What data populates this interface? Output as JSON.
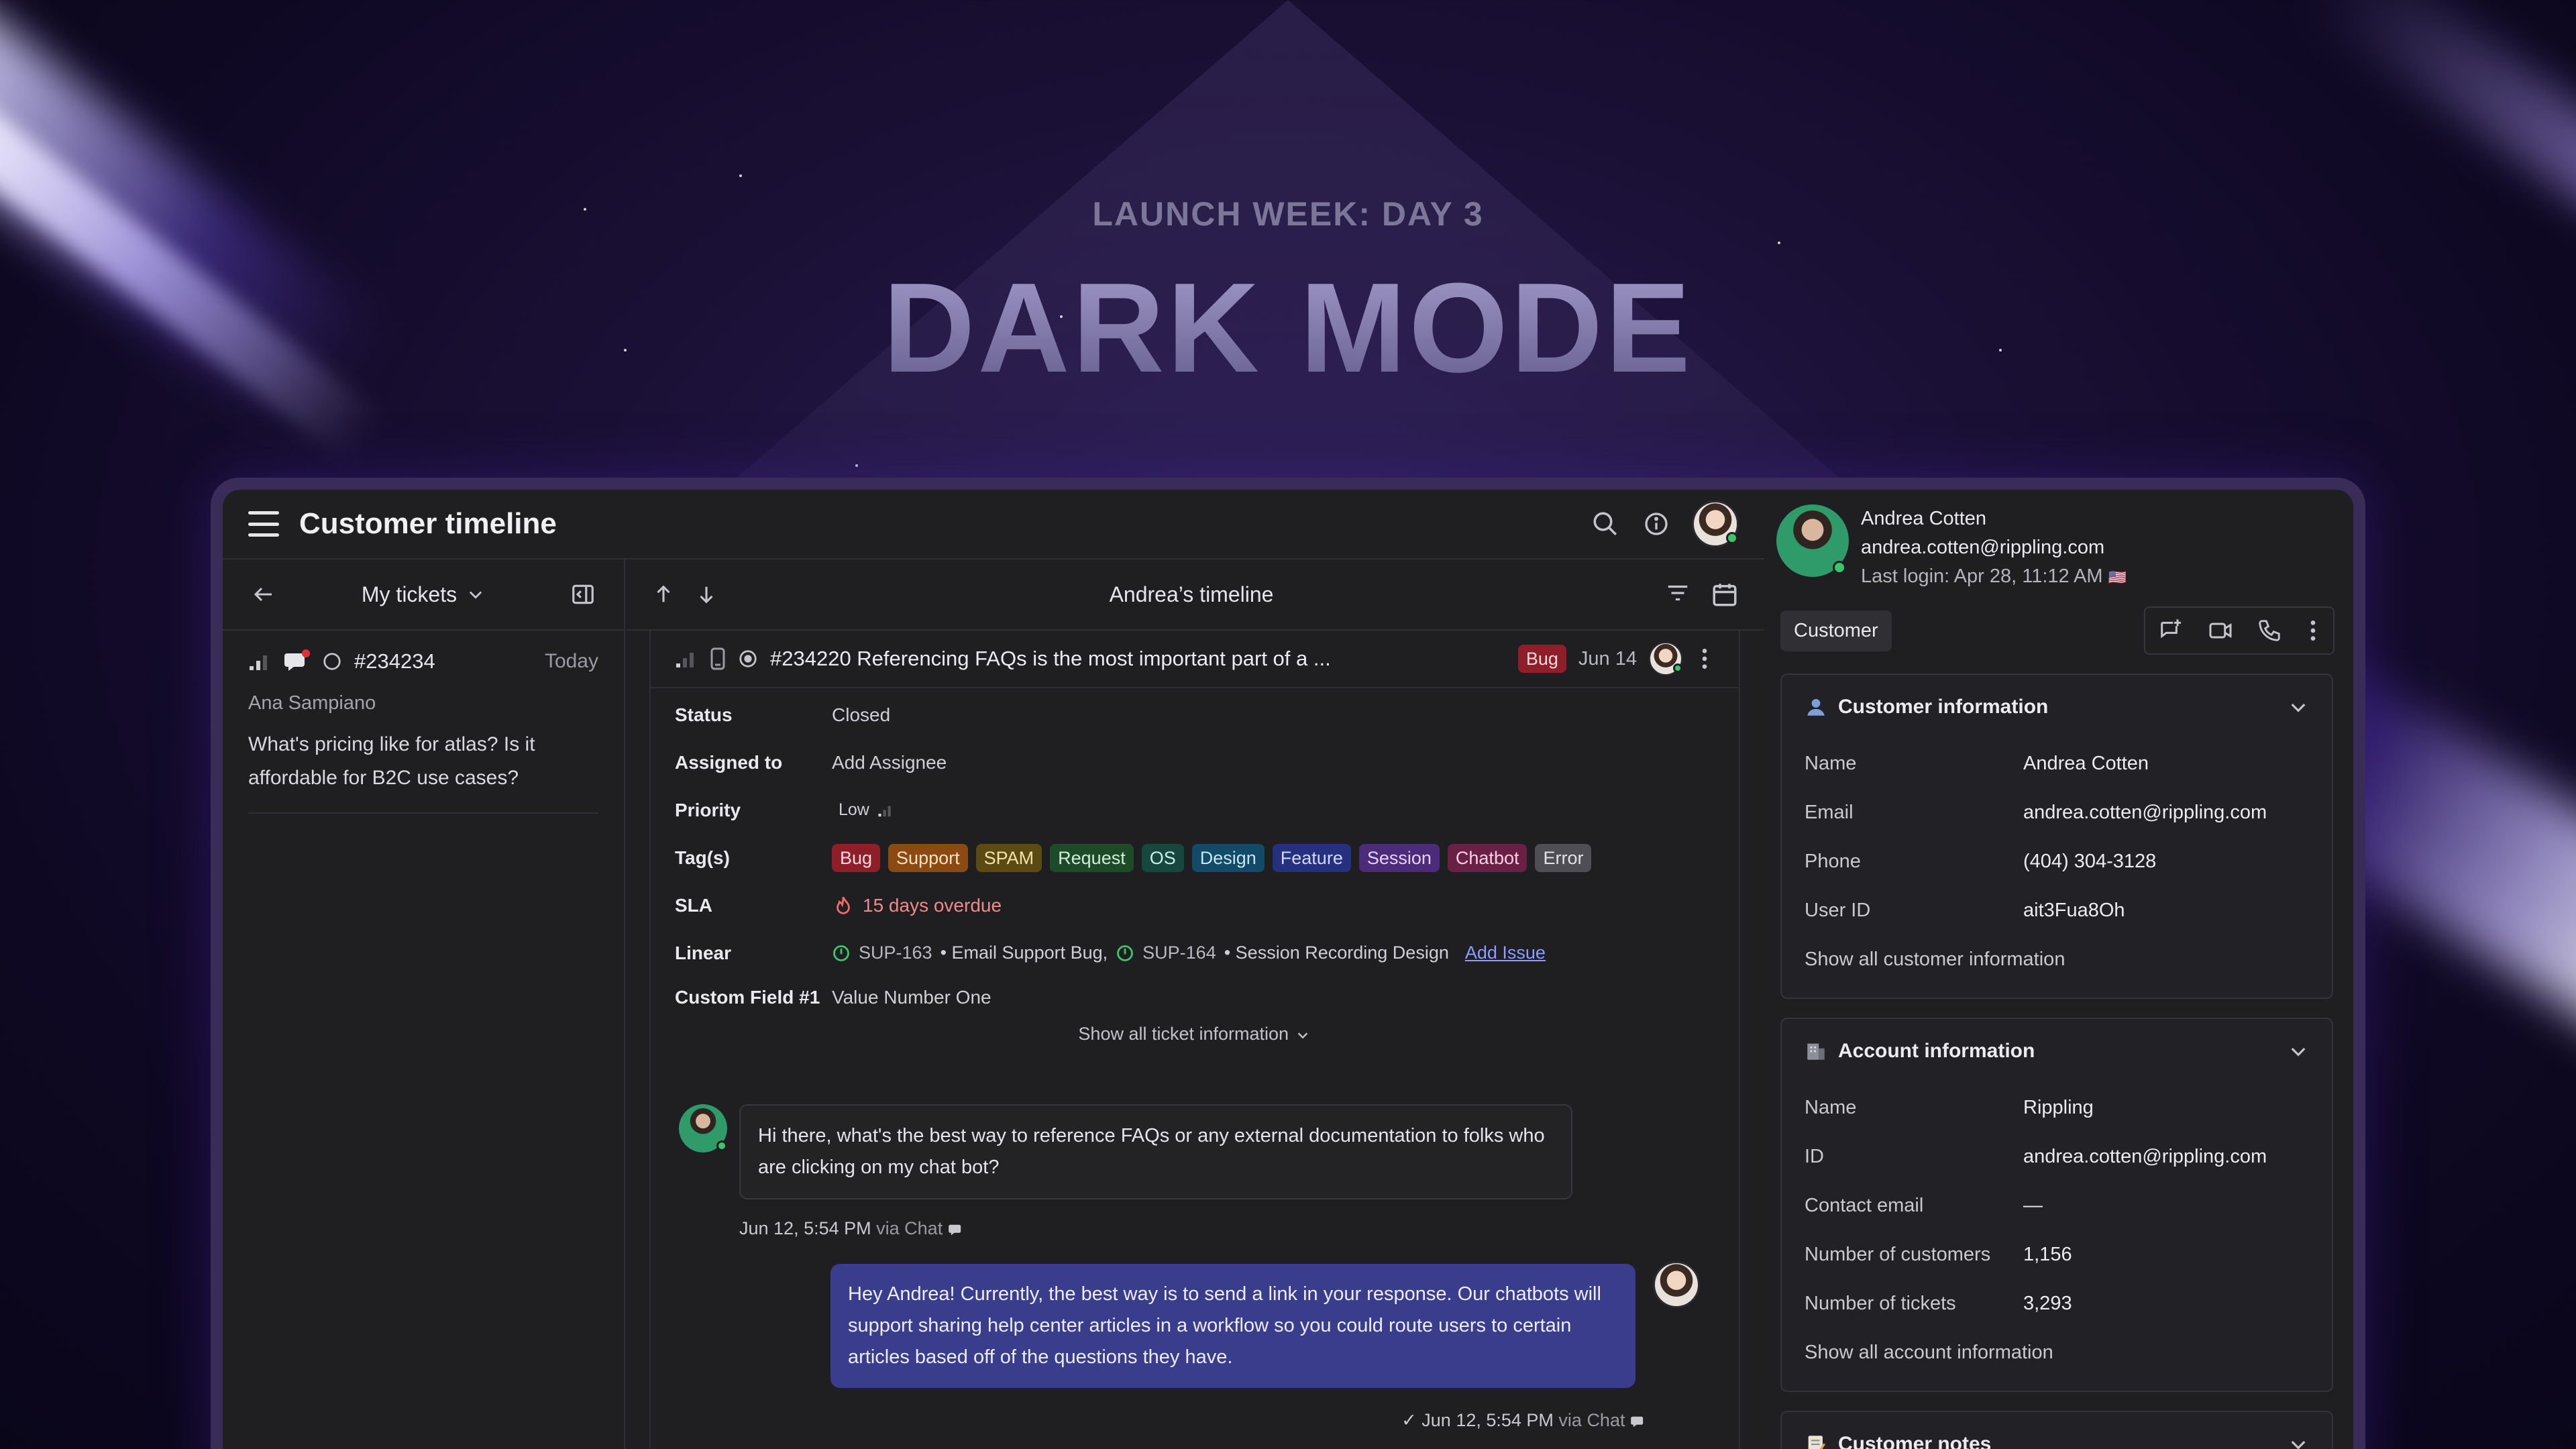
{
  "banner": {
    "eyebrow": "LAUNCH WEEK: DAY 3",
    "headline": "DARK MODE"
  },
  "app": {
    "title": "Customer timeline",
    "left": {
      "filter_label": "My tickets",
      "ticket": {
        "number": "#234234",
        "when": "Today",
        "customer": "Ana Sampiano",
        "message": "What's pricing like for atlas? Is it affordable for B2C use cases?"
      }
    },
    "timeline": {
      "title": "Andrea’s timeline",
      "ticket": {
        "title": "#234220 Referencing FAQs is the most important part of a ...",
        "badge": "Bug",
        "date": "Jun 14"
      },
      "fields": {
        "status_k": "Status",
        "status_v": "Closed",
        "assigned_k": "Assigned to",
        "assigned_v": "Add Assignee",
        "priority_k": "Priority",
        "priority_v": "Low",
        "tags_k": "Tag(s)",
        "sla_k": "SLA",
        "sla_v": "15 days overdue",
        "linear_k": "Linear",
        "linear_1_id": "SUP-163",
        "linear_1_title": "• Email Support Bug,",
        "linear_2_id": "SUP-164",
        "linear_2_title": "• Session Recording Design",
        "linear_add": "Add Issue",
        "custom_k": "Custom Field #1",
        "custom_v": "Value Number One"
      },
      "tags": [
        {
          "label": "Bug",
          "bg": "#8e1f2a",
          "fg": "#ffd9dc"
        },
        {
          "label": "Support",
          "bg": "#8a4a12",
          "fg": "#ffe1c2"
        },
        {
          "label": "SPAM",
          "bg": "#5b4a12",
          "fg": "#f4e3a8"
        },
        {
          "label": "Request",
          "bg": "#1f4a2a",
          "fg": "#cdeed6"
        },
        {
          "label": "OS",
          "bg": "#17473f",
          "fg": "#c7eee5"
        },
        {
          "label": "Design",
          "bg": "#134a68",
          "fg": "#c6e6f7"
        },
        {
          "label": "Feature",
          "bg": "#25307e",
          "fg": "#d3d8ff"
        },
        {
          "label": "Session",
          "bg": "#4b2b7a",
          "fg": "#e3d3ff"
        },
        {
          "label": "Chatbot",
          "bg": "#6a1f45",
          "fg": "#ffd1e6"
        },
        {
          "label": "Error",
          "bg": "#4e4e54",
          "fg": "#e2e2e6"
        }
      ],
      "show_all": "Show all ticket information",
      "messages": {
        "in_text": "Hi there, what's the best way to reference FAQs or any external documentation to folks who are clicking on my chat bot?",
        "in_meta_time": "Jun 12, 5:54 PM",
        "in_meta_via": "via Chat",
        "out_text": "Hey Andrea! Currently, the best way is to send a link in your response. Our chatbots will support sharing help center articles in a workflow so you could route users to certain articles based off of the questions they have.",
        "out_meta_time": "✓ Jun 12, 5:54 PM",
        "out_meta_via": "via Chat"
      }
    },
    "customer": {
      "name": "Andrea Cotten",
      "email": "andrea.cotten@rippling.com",
      "last_login": "Last login: Apr 28, 11:12 AM",
      "flag": "🇺🇸",
      "chip": "Customer",
      "info_title": "Customer information",
      "info_rows": [
        {
          "k": "Name",
          "v": "Andrea Cotten"
        },
        {
          "k": "Email",
          "v": "andrea.cotten@rippling.com"
        },
        {
          "k": "Phone",
          "v": "(404) 304-3128"
        },
        {
          "k": "User ID",
          "v": "ait3Fua8Oh"
        }
      ],
      "info_more": "Show all customer information",
      "account_title": "Account information",
      "account_rows": [
        {
          "k": "Name",
          "v": "Rippling"
        },
        {
          "k": "ID",
          "v": "andrea.cotten@rippling.com"
        },
        {
          "k": "Contact email",
          "v": "—"
        },
        {
          "k": "Number of customers",
          "v": "1,156"
        },
        {
          "k": "Number of tickets",
          "v": "3,293"
        }
      ],
      "account_more": "Show all account information",
      "notes_title": "Customer notes"
    }
  }
}
